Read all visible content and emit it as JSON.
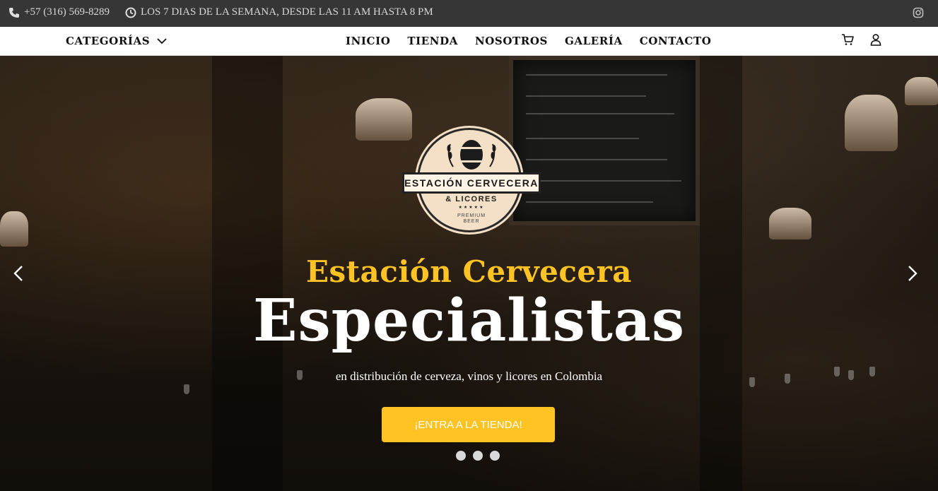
{
  "topbar": {
    "phone": "+57 (316) 569-8289",
    "hours": "LOS 7 DIAS DE LA SEMANA, DESDE LAS 11 AM HASTA 8 PM",
    "icons": [
      "phone-icon",
      "clock-icon",
      "instagram-icon"
    ]
  },
  "nav": {
    "categories": "CATEGORÍAS",
    "menu": [
      {
        "label": "INICIO"
      },
      {
        "label": "TIENDA"
      },
      {
        "label": "NOSOTROS"
      },
      {
        "label": "GALERÍA"
      },
      {
        "label": "CONTACTO"
      }
    ],
    "icons": [
      "cart-icon",
      "user-icon"
    ]
  },
  "logo": {
    "name": "ESTACIÓN CERVECERA",
    "sub": "& LICORES",
    "stars": "★★★★★",
    "tagline1": "PREMIUM",
    "tagline2": "BEER"
  },
  "hero": {
    "title": "Estación Cervecera",
    "headline": "Especialistas",
    "subtitle": "en distribución de cerveza, vinos y licores en Colombia",
    "cta": "¡ENTRA A LA TIENDA!",
    "slides": 3
  },
  "colors": {
    "accent": "#ffc324",
    "topbar": "#363636",
    "nav_bg": "#ffffff"
  }
}
